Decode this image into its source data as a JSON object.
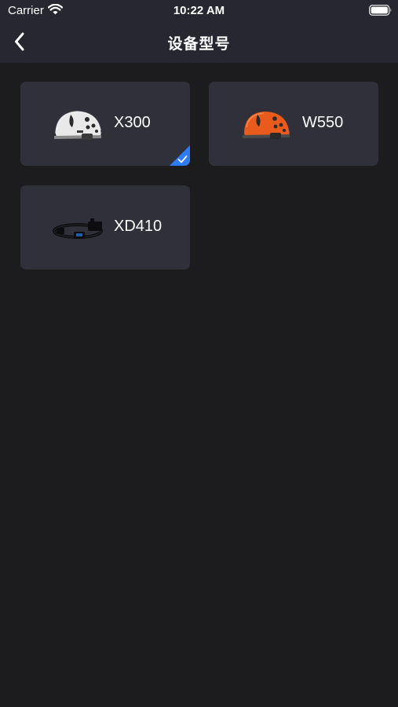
{
  "status_bar": {
    "carrier": "Carrier",
    "time": "10:22 AM",
    "icons": [
      "wifi-icon",
      "battery-icon"
    ]
  },
  "nav": {
    "title": "设备型号",
    "back_icon": "chevron-left-icon"
  },
  "devices": [
    {
      "label": "X300",
      "image": "white-helmet",
      "color": "#e9e9e9",
      "selected": true
    },
    {
      "label": "W550",
      "image": "orange-helmet",
      "color": "#e85b1c",
      "selected": false
    },
    {
      "label": "XD410",
      "image": "head-mounted-camera",
      "color": "#0d0d0f",
      "selected": false
    }
  ],
  "theme": {
    "background": "#1c1c1e",
    "header": "#262730",
    "card": "#30303b",
    "accent": "#2d7cf6"
  }
}
